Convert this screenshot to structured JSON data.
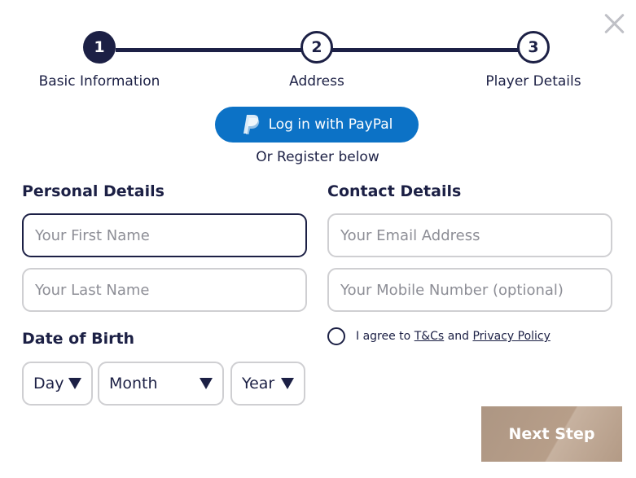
{
  "steps": [
    {
      "number": "1",
      "label": "Basic Information",
      "state": "active"
    },
    {
      "number": "2",
      "label": "Address",
      "state": "inactive"
    },
    {
      "number": "3",
      "label": "Player Details",
      "state": "inactive"
    }
  ],
  "paypal": {
    "label": "Log in with PayPal",
    "icon": "paypal-icon",
    "color": "#0c72c6"
  },
  "or_register": "Or Register below",
  "personal": {
    "title": "Personal Details",
    "first_name_placeholder": "Your First Name",
    "last_name_placeholder": "Your Last Name"
  },
  "dob": {
    "title": "Date of Birth",
    "day": "Day",
    "month": "Month",
    "year": "Year"
  },
  "contact": {
    "title": "Contact Details",
    "email_placeholder": "Your Email Address",
    "mobile_placeholder": "Your Mobile Number (optional)"
  },
  "agree": {
    "prefix": "I agree to",
    "tcs": "T&Cs",
    "and": "and",
    "privacy": "Privacy Policy"
  },
  "next_label": "Next Step",
  "close_icon": "close-icon",
  "colors": {
    "navy": "#1c2045",
    "paypal_blue": "#0c72c6",
    "next_button": "#b39a85"
  }
}
